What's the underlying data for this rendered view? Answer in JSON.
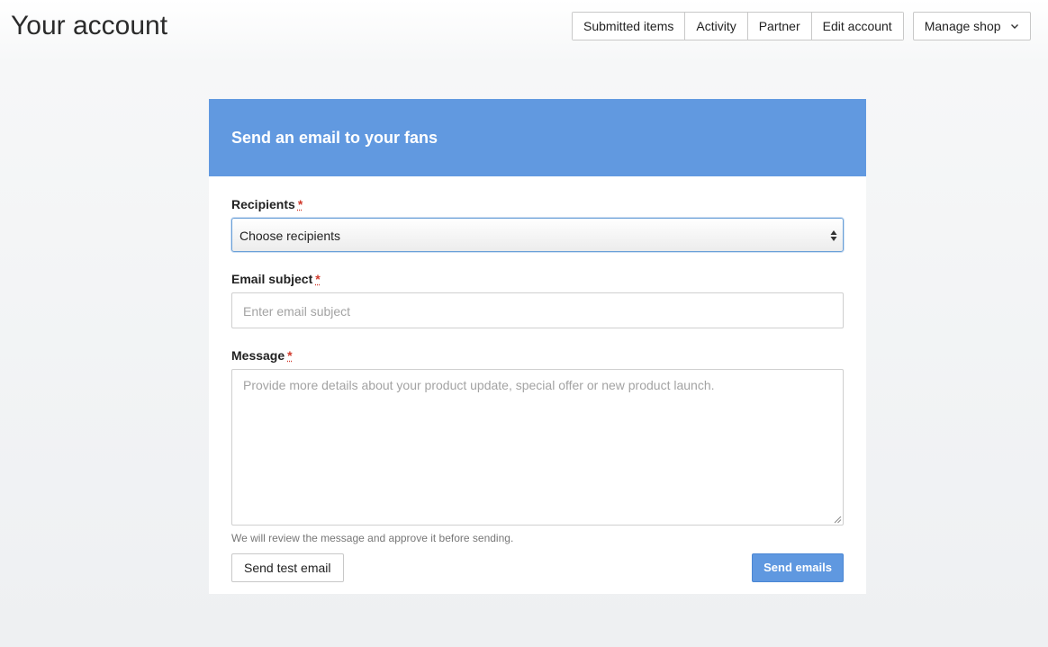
{
  "page": {
    "title": "Your account"
  },
  "nav": {
    "items": [
      {
        "label": "Submitted items"
      },
      {
        "label": "Activity"
      },
      {
        "label": "Partner"
      },
      {
        "label": "Edit account"
      }
    ],
    "manage_shop": {
      "label": "Manage shop",
      "icon": "chevron-down-icon"
    }
  },
  "form": {
    "header": "Send an email to your fans",
    "required_marker": "*",
    "recipients": {
      "label": "Recipients",
      "value": "Choose recipients"
    },
    "subject": {
      "label": "Email subject",
      "placeholder": "Enter email subject"
    },
    "message": {
      "label": "Message",
      "placeholder": "Provide more details about your product update, special offer or new product launch."
    },
    "help_text": "We will review the message and approve it before sending.",
    "send_test_label": "Send test email",
    "send_label": "Send emails"
  },
  "colors": {
    "header_bg": "#6199e0",
    "primary_button": "#5f98e0",
    "required": "#d0392b"
  }
}
